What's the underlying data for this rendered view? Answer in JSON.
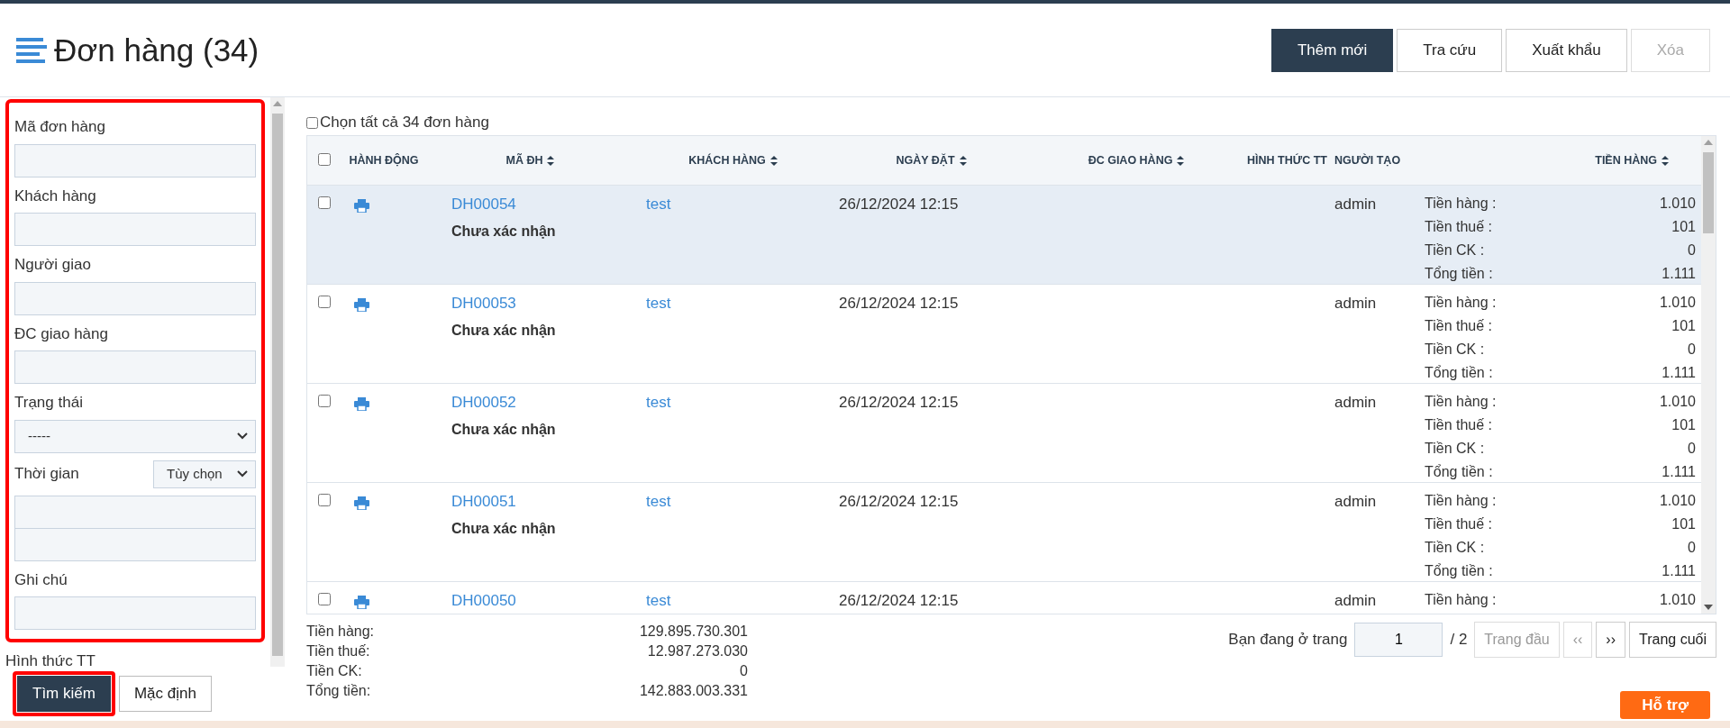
{
  "page": {
    "title": "Đơn hàng (34)"
  },
  "actions": [
    {
      "label": "Thêm mới",
      "kind": "primary",
      "disabled": false
    },
    {
      "label": "Tra cứu",
      "kind": "outline",
      "disabled": false
    },
    {
      "label": "Xuất khẩu",
      "kind": "outline",
      "disabled": false
    },
    {
      "label": "Xóa",
      "kind": "outline",
      "disabled": true
    }
  ],
  "filters": {
    "highlighted": true,
    "fields": [
      {
        "kind": "text",
        "label": "Mã đơn hàng"
      },
      {
        "kind": "text",
        "label": "Khách hàng"
      },
      {
        "kind": "text",
        "label": "Người giao"
      },
      {
        "kind": "text",
        "label": "ĐC giao hàng"
      },
      {
        "kind": "select",
        "label": "Trạng thái",
        "value": "-----"
      },
      {
        "kind": "range",
        "label": "Thời gian",
        "value": "Tùy chọn"
      },
      {
        "kind": "text",
        "label": "Ghi chú"
      }
    ]
  },
  "filters_below": [
    {
      "kind": "text",
      "label": "Hình thức TT"
    }
  ],
  "filter_buttons": [
    {
      "label": "Tìm kiếm",
      "kind": "primary",
      "highlighted": true
    },
    {
      "label": "Mặc định",
      "kind": "outline",
      "highlighted": false
    }
  ],
  "select_all": {
    "label": "Chọn tất cả 34 đơn hàng",
    "checked": false
  },
  "table": {
    "header_checked": false,
    "columns": [
      {
        "label": "HÀNH ĐỘNG",
        "sortable": false
      },
      {
        "label": "MÃ ĐH",
        "sortable": true
      },
      {
        "label": "KHÁCH HÀNG",
        "sortable": true
      },
      {
        "label": "NGÀY ĐẶT",
        "sortable": true
      },
      {
        "label": "ĐC GIAO HÀNG",
        "sortable": true
      },
      {
        "label": "HÌNH THỨC TT",
        "sortable": false
      },
      {
        "label": "NGƯỜI TẠO",
        "sortable": false
      },
      {
        "label": "TIỀN HÀNG",
        "sortable": true
      }
    ],
    "rows": [
      {
        "checked": false,
        "selected": true,
        "code": "DH00054",
        "status": "Chưa xác nhận",
        "customer": "test",
        "date": "26/12/2024 12:15",
        "creator": "admin",
        "summary": [
          {
            "label": "Tiền hàng :",
            "value": "1.010"
          },
          {
            "label": "Tiền thuế :",
            "value": "101"
          },
          {
            "label": "Tiền CK :",
            "value": "0"
          },
          {
            "label": "Tổng tiền :",
            "value": "1.111"
          }
        ]
      },
      {
        "checked": false,
        "selected": false,
        "code": "DH00053",
        "status": "Chưa xác nhận",
        "customer": "test",
        "date": "26/12/2024 12:15",
        "creator": "admin",
        "summary": [
          {
            "label": "Tiền hàng :",
            "value": "1.010"
          },
          {
            "label": "Tiền thuế :",
            "value": "101"
          },
          {
            "label": "Tiền CK :",
            "value": "0"
          },
          {
            "label": "Tổng tiền :",
            "value": "1.111"
          }
        ]
      },
      {
        "checked": false,
        "selected": false,
        "code": "DH00052",
        "status": "Chưa xác nhận",
        "customer": "test",
        "date": "26/12/2024 12:15",
        "creator": "admin",
        "summary": [
          {
            "label": "Tiền hàng :",
            "value": "1.010"
          },
          {
            "label": "Tiền thuế :",
            "value": "101"
          },
          {
            "label": "Tiền CK :",
            "value": "0"
          },
          {
            "label": "Tổng tiền :",
            "value": "1.111"
          }
        ]
      },
      {
        "checked": false,
        "selected": false,
        "code": "DH00051",
        "status": "Chưa xác nhận",
        "customer": "test",
        "date": "26/12/2024 12:15",
        "creator": "admin",
        "summary": [
          {
            "label": "Tiền hàng :",
            "value": "1.010"
          },
          {
            "label": "Tiền thuế :",
            "value": "101"
          },
          {
            "label": "Tiền CK :",
            "value": "0"
          },
          {
            "label": "Tổng tiền :",
            "value": "1.111"
          }
        ]
      },
      {
        "checked": false,
        "selected": false,
        "code": "DH00050",
        "customer": "test",
        "date": "26/12/2024 12:15",
        "creator": "admin",
        "summary": [
          {
            "label": "Tiền hàng :",
            "value": "1.010"
          }
        ]
      }
    ]
  },
  "totals": [
    {
      "label": "Tiền hàng:",
      "value": "129.895.730.301"
    },
    {
      "label": "Tiền thuế:",
      "value": "12.987.273.030"
    },
    {
      "label": "Tiền CK:",
      "value": "0"
    },
    {
      "label": "Tổng tiền:",
      "value": "142.883.003.331"
    }
  ],
  "pager": {
    "prefix": "Bạn đang ở trang",
    "page": "1",
    "total": "/ 2",
    "buttons": [
      {
        "label": "Trang đầu",
        "disabled": true
      },
      {
        "label": "‹‹",
        "disabled": true
      },
      {
        "label": "››",
        "disabled": false
      },
      {
        "label": "Trang cuối",
        "disabled": false
      }
    ]
  },
  "help_button": {
    "label": "Hỗ trợ"
  }
}
